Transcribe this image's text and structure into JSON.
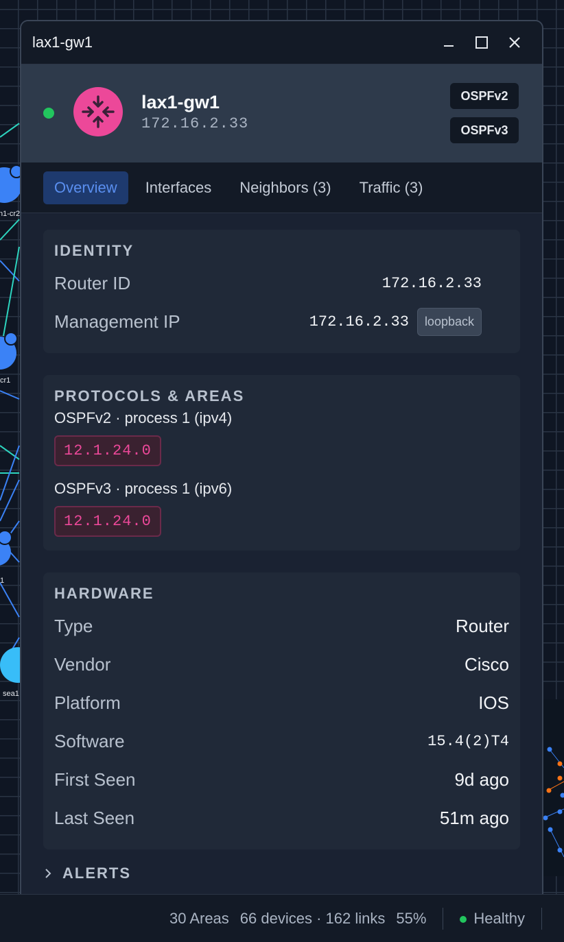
{
  "window": {
    "title": "lax1-gw1"
  },
  "device": {
    "name": "lax1-gw1",
    "ip": "172.16.2.33",
    "status_color": "#22c55e",
    "badges": [
      "OSPFv2",
      "OSPFv3"
    ]
  },
  "tabs": [
    {
      "label": "Overview",
      "active": true
    },
    {
      "label": "Interfaces",
      "active": false
    },
    {
      "label": "Neighbors (3)",
      "active": false
    },
    {
      "label": "Traffic (3)",
      "active": false
    }
  ],
  "identity": {
    "title": "IDENTITY",
    "router_id_label": "Router ID",
    "router_id": "172.16.2.33",
    "mgmt_label": "Management IP",
    "mgmt_ip": "172.16.2.33",
    "mgmt_badge": "loopback"
  },
  "protocols": {
    "title": "PROTOCOLS & AREAS",
    "items": [
      {
        "label": "OSPFv2 · process 1 (ipv4)",
        "area": "12.1.24.0"
      },
      {
        "label": "OSPFv3 · process 1 (ipv6)",
        "area": "12.1.24.0"
      }
    ]
  },
  "hardware": {
    "title": "HARDWARE",
    "rows": [
      {
        "k": "Type",
        "v": "Router"
      },
      {
        "k": "Vendor",
        "v": "Cisco"
      },
      {
        "k": "Platform",
        "v": "IOS"
      },
      {
        "k": "Software",
        "v": "15.4(2)T4"
      },
      {
        "k": "First Seen",
        "v": "9d ago"
      },
      {
        "k": "Last Seen",
        "v": "51m ago"
      }
    ]
  },
  "alerts": {
    "title": "ALERTS"
  },
  "statusbar": {
    "areas": "30 Areas",
    "counts": "66 devices · 162 links",
    "zoom": "55%",
    "health": "Healthy"
  },
  "background": {
    "node_labels": [
      "n1-cr2",
      "cr1",
      "1",
      "sea1"
    ]
  },
  "colors": {
    "accent": "#5a8ff0",
    "router_pink": "#ec4899",
    "healthy": "#22c55e",
    "node_blue": "#3b82f6"
  }
}
